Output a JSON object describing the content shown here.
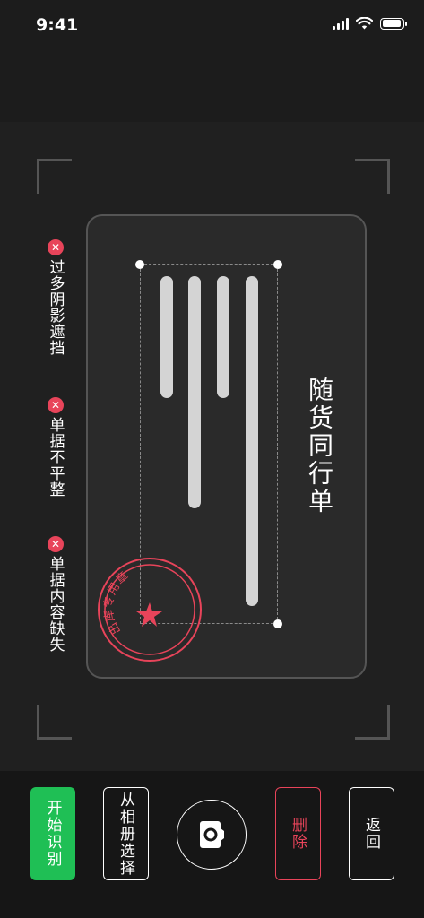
{
  "status_bar": {
    "time": "9:41"
  },
  "tips": [
    {
      "icon": "x-circle-icon",
      "label": "过多阴影遮挡"
    },
    {
      "icon": "x-circle-icon",
      "label": "单据不平整"
    },
    {
      "icon": "x-circle-icon",
      "label": "单据内容缺失"
    }
  ],
  "document": {
    "title": "随货同行单",
    "stamp_text": "出库专用章",
    "stamp_color": "#e8445a"
  },
  "actions": {
    "start_recognition": "开始识别",
    "choose_from_album": "从相册选择",
    "shutter": "camera-icon",
    "delete": "删除",
    "back": "返回"
  },
  "colors": {
    "accent_green": "#1fbf55",
    "danger_red": "#e8445a",
    "background": "#1c1c1c"
  }
}
